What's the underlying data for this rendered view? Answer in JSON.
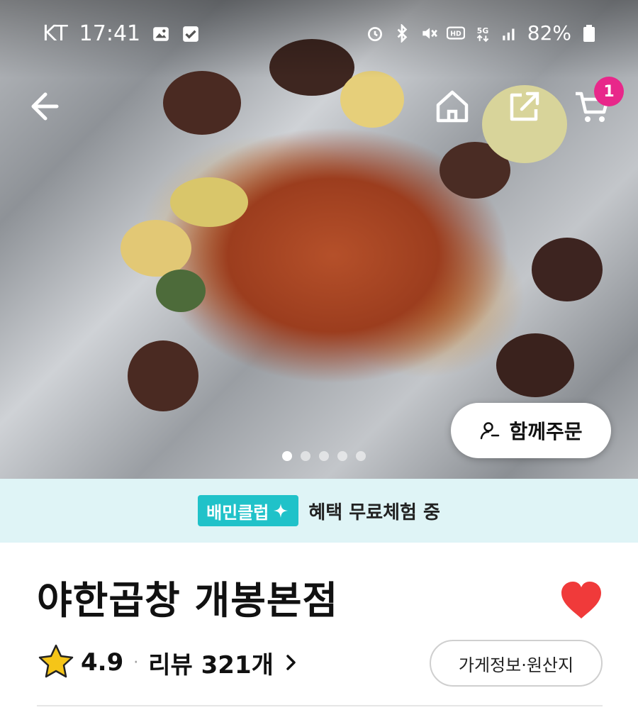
{
  "status_bar": {
    "carrier": "KT",
    "time": "17:41",
    "battery": "82%",
    "icons": [
      "gallery-icon",
      "check-icon",
      "alarm-icon",
      "bluetooth-icon",
      "mute-icon",
      "hd-icon",
      "5g-icon",
      "signal-icon",
      "battery-icon"
    ]
  },
  "nav": {
    "icons": [
      "back-arrow-icon",
      "home-icon",
      "share-icon",
      "cart-icon"
    ],
    "cart_badge": "1"
  },
  "hero": {
    "group_order_label": "함께주문",
    "carousel_total": 5,
    "carousel_active": 1
  },
  "club_banner": {
    "logo_text": "배민클럽",
    "text": "혜택 무료체험 중"
  },
  "store": {
    "name": "야한곱창 개봉본점",
    "favorited": true,
    "rating": "4.9",
    "review_label": "리뷰 321개",
    "info_button": "가게정보·원산지"
  },
  "colors": {
    "accent_pink": "#e8278a",
    "club_teal": "#20c2c9",
    "club_bg": "#dff4f6",
    "heart_red": "#f03a3a",
    "star_yellow": "#f5c518"
  }
}
